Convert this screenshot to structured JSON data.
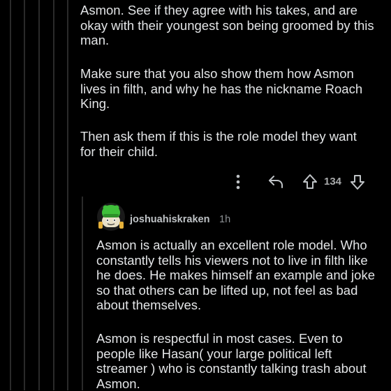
{
  "parent_comment": {
    "paragraphs": [
      "Asmon. See if they agree with his takes, and are\nokay with their youngest son being groomed by this\nman.",
      "Make sure that you also show them how Asmon\nlives in filth, and why he has the nickname Roach\nKing.",
      "Then ask them if this is the role model they want\nfor their child."
    ],
    "vote_count": "134",
    "icons": [
      "more-vertical-icon",
      "reply-icon",
      "upvote-arrow-icon",
      "downvote-arrow-icon"
    ]
  },
  "reply_comment": {
    "username": "joshuahiskraken",
    "timestamp": "1h",
    "avatar_icon": "snoo-avatar-icon",
    "paragraphs": [
      "Asmon is actually an excellent role model. Who\nconstantly tells his viewers not to live in filth like\nhe does. He makes himself an example and joke\nso that others can be lifted up, not feel as bad\nabout themselves.",
      "Asmon is respectful in most cases. Even to\npeople like Hasan( your large political left\nstreamer ) who is constantly talking trash about\nAsmon."
    ]
  },
  "colors": {
    "background": "#000000",
    "text": "#e3e5e7",
    "muted": "#a8aaab",
    "thread_line": "#2a2a2a",
    "avatar_green": "#3fbf3a"
  }
}
